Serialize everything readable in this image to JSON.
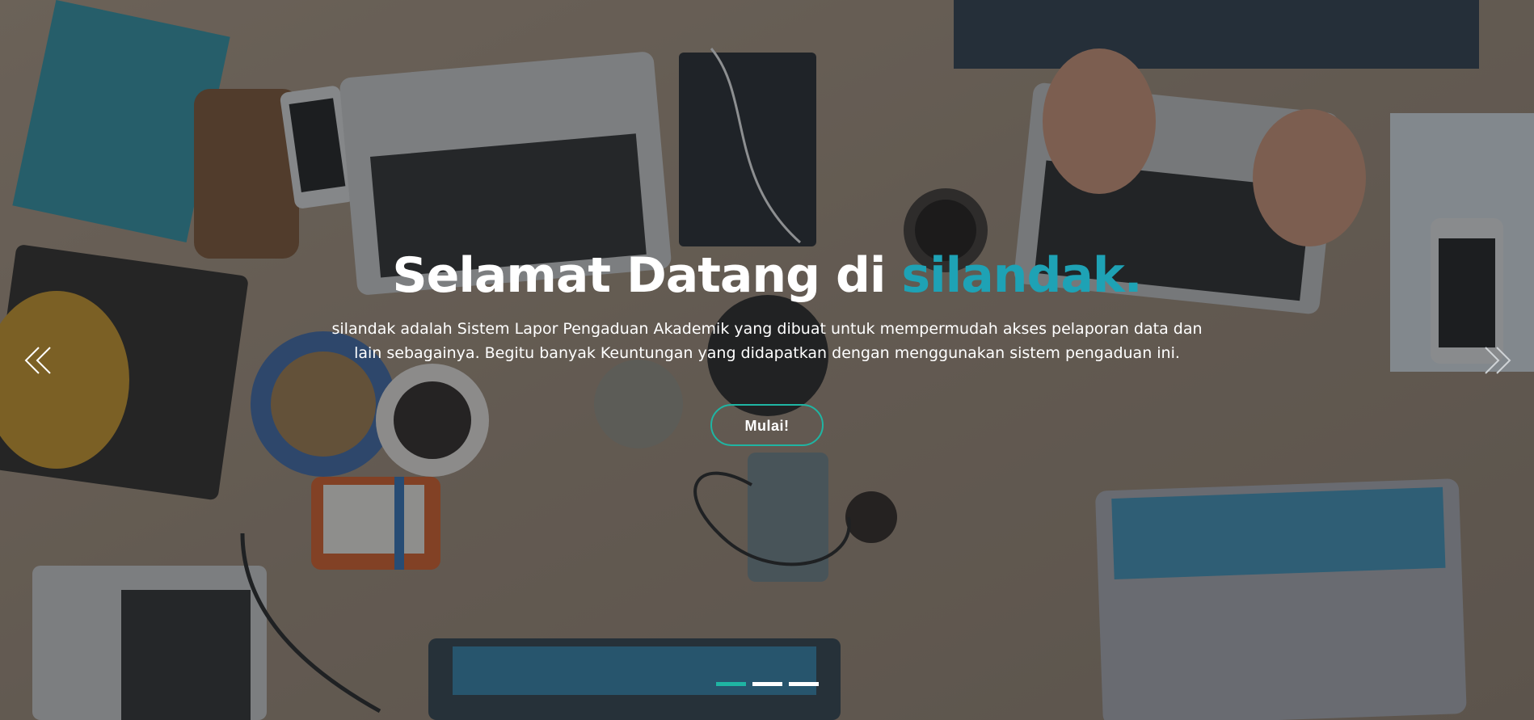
{
  "hero": {
    "title_prefix": "Selamat Datang di ",
    "title_accent": "silandak.",
    "description": "silandak adalah Sistem Lapor Pengaduan Akademik yang dibuat untuk mempermudah akses pelaporan data dan lain sebagainya. Begitu banyak Keuntungan yang didapatkan dengan menggunakan sistem pengaduan ini.",
    "cta_label": "Mulai!"
  },
  "carousel": {
    "prev_icon": "double-chevron-left-icon",
    "next_icon": "double-chevron-right-icon",
    "slide_count": 3,
    "active_slide": 1
  },
  "colors": {
    "accent": "#1ea2b5",
    "button_border": "#1fb5a3",
    "active_indicator": "#1fb5a3"
  }
}
